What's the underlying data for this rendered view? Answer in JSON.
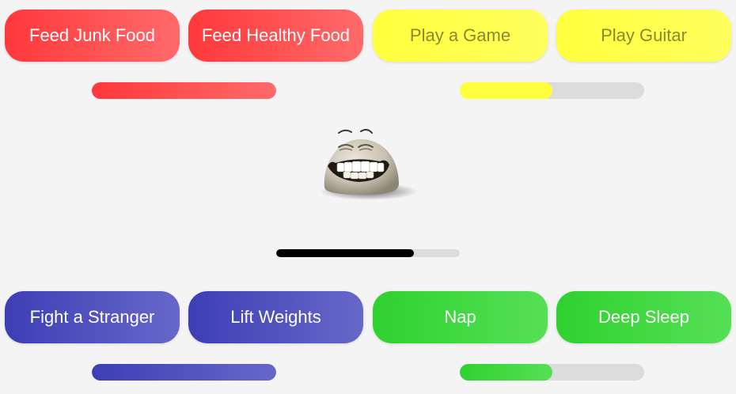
{
  "buttons": {
    "feed_junk": "Feed Junk Food",
    "feed_healthy": "Feed Healthy Food",
    "play_game": "Play a Game",
    "play_guitar": "Play Guitar",
    "fight_stranger": "Fight a Stranger",
    "lift_weights": "Lift Weights",
    "nap": "Nap",
    "deep_sleep": "Deep Sleep"
  },
  "meters": {
    "hunger": 1.0,
    "fun": 0.5,
    "strength": 1.0,
    "energy": 0.5,
    "overall": 0.75
  },
  "pet": {
    "icon": "grinning-blob-creature-icon"
  },
  "colors": {
    "food": "#ff383b",
    "play": "#ffff3d",
    "exercise": "#3e3eb5",
    "sleep": "#2fd12f",
    "overall": "#000000",
    "track": "#dcdcdc"
  }
}
